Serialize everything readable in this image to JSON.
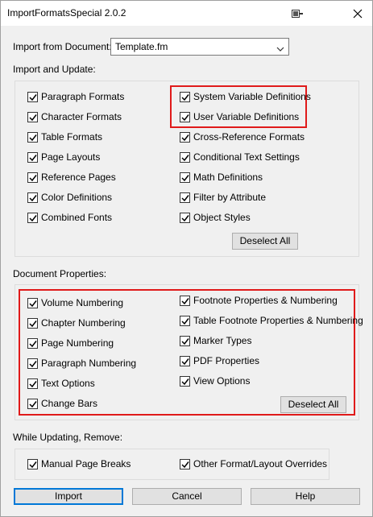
{
  "window": {
    "title": "ImportFormatsSpecial 2.0.2"
  },
  "import_from": {
    "label": "Import from Document:",
    "value": "Template.fm"
  },
  "import_update": {
    "label": "Import and Update:",
    "left": [
      "Paragraph Formats",
      "Character Formats",
      "Table Formats",
      "Page Layouts",
      "Reference Pages",
      "Color Definitions",
      "Combined Fonts"
    ],
    "right": [
      "System Variable Definitions",
      "User Variable Definitions",
      "Cross-Reference Formats",
      "Conditional Text Settings",
      "Math Definitions",
      "Filter by Attribute",
      "Object Styles"
    ],
    "deselect": "Deselect All"
  },
  "doc_props": {
    "label": "Document Properties:",
    "left": [
      "Volume Numbering",
      "Chapter Numbering",
      "Page Numbering",
      "Paragraph Numbering",
      "Text Options",
      "Change Bars"
    ],
    "right": [
      "Footnote Properties & Numbering",
      "Table Footnote Properties & Numbering",
      "Marker Types",
      "PDF Properties",
      "View Options"
    ],
    "deselect": "Deselect All"
  },
  "remove": {
    "label": "While Updating, Remove:",
    "left": "Manual Page Breaks",
    "right": "Other Format/Layout Overrides"
  },
  "buttons": {
    "import": "Import",
    "cancel": "Cancel",
    "help": "Help"
  },
  "colors": {
    "highlight": "#e01a1a",
    "default_button": "#0078d7"
  }
}
